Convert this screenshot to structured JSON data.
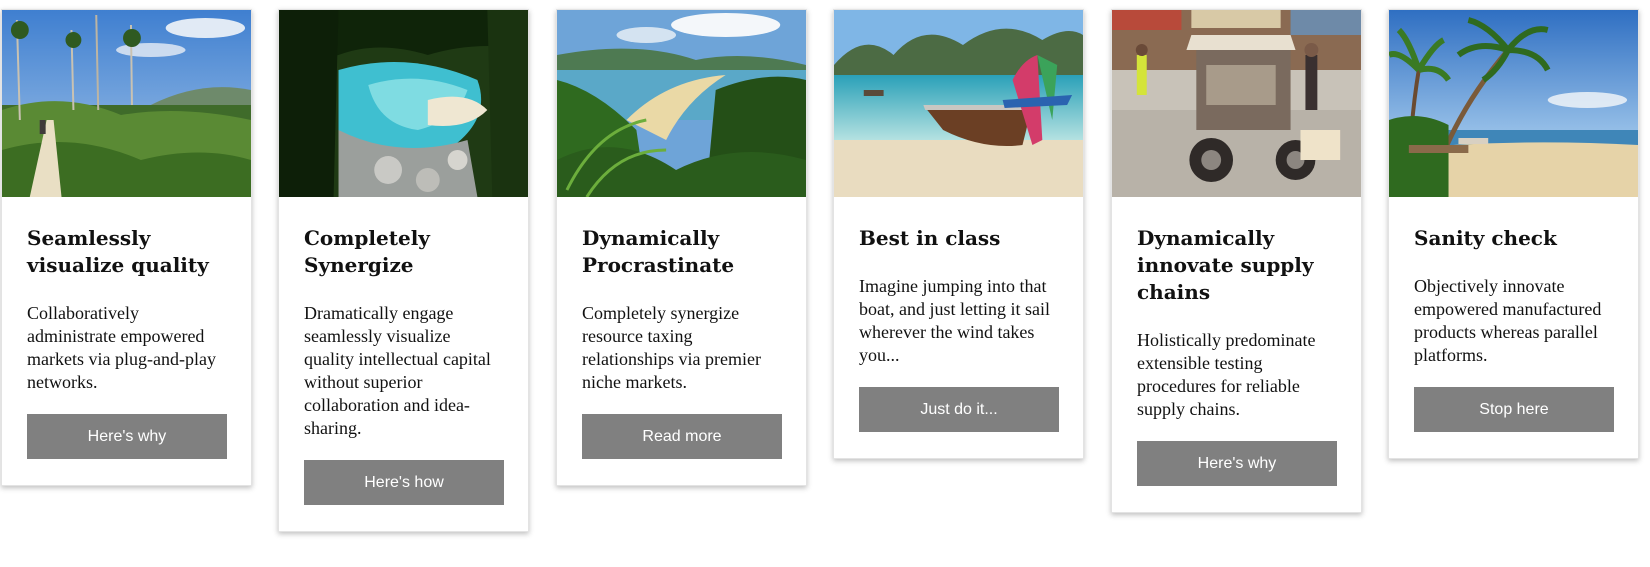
{
  "cards": [
    {
      "title": "Seamlessly visualize quality",
      "text": "Collaboratively administrate empowered markets via plug-and-play networks.",
      "button": "Here's why",
      "image": "coastal-trail-photo"
    },
    {
      "title": "Completely Synergize",
      "text": "Dramatically engage seamlessly visualize quality intellectual capital without superior collaboration and idea-sharing.",
      "button": "Here's how",
      "image": "lagoon-cove-photo"
    },
    {
      "title": "Dynamically Procrastinate",
      "text": "Completely synergize resource taxing relationships via premier niche markets.",
      "button": "Read more",
      "image": "fern-bay-photo"
    },
    {
      "title": "Best in class",
      "text": "Imagine jumping into that boat, and just letting it sail wherever the wind takes you...",
      "button": "Just do it...",
      "image": "longtail-boat-photo"
    },
    {
      "title": "Dynamically innovate supply chains",
      "text": "Holistically predominate extensible testing procedures for reliable supply chains.",
      "button": "Here's why",
      "image": "street-tuktuk-photo"
    },
    {
      "title": "Sanity check",
      "text": "Objectively innovate empowered manufactured products whereas parallel platforms.",
      "button": "Stop here",
      "image": "palm-beach-photo"
    }
  ]
}
